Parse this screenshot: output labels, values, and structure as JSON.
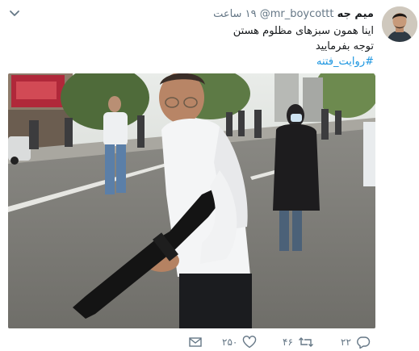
{
  "tweet": {
    "display_name": "میم جه",
    "handle": "@mr_boycottt",
    "time_value": "۱۹",
    "time_unit": "ساعت",
    "text_line_1": "اینا همون سبزهای مظلوم هستن",
    "text_line_2": "توجه بفرمایید",
    "hashtag": "#روایت_فتنه"
  },
  "actions": {
    "reply_count": "۲۲",
    "retweet_count": "۴۶",
    "like_count": "۲۵۰"
  },
  "icons": {
    "caret": "chevron-down-icon",
    "reply": "reply-icon",
    "retweet": "retweet-icon",
    "like": "heart-icon",
    "message": "envelope-icon"
  },
  "colors": {
    "link": "#1b95e0",
    "secondary_text": "#657786",
    "primary_text": "#14171a"
  }
}
